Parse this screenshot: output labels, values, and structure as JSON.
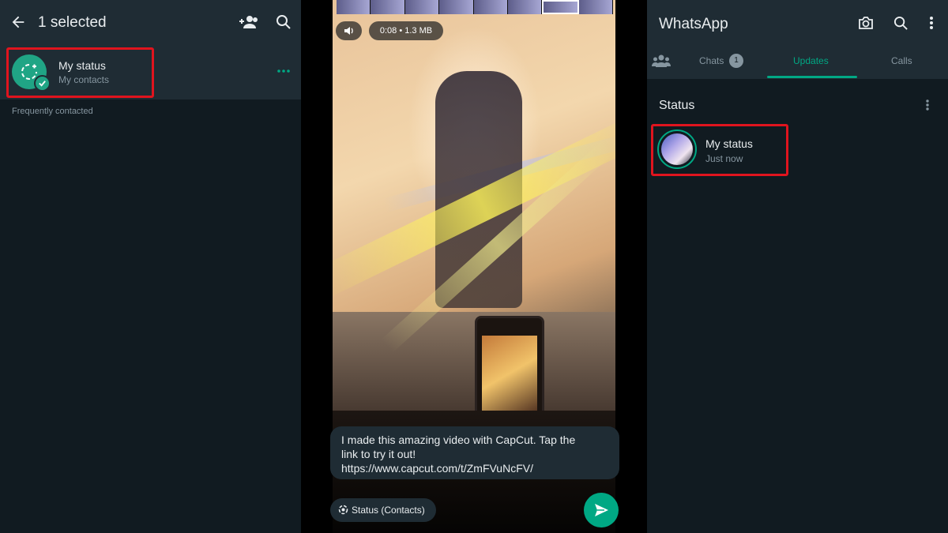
{
  "left_panel": {
    "header": {
      "title": "1 selected"
    },
    "my_status": {
      "name": "My status",
      "subtitle": "My contacts"
    },
    "section_label": "Frequently contacted"
  },
  "center_panel": {
    "video_meta": {
      "duration_size": "0:08  •  1.3 MB"
    },
    "caption": {
      "line1": "I made this amazing video with CapCut. Tap the",
      "line2": "link to try it out!",
      "line3": "https://www.capcut.com/t/ZmFVuNcFV/"
    },
    "status_chip": "Status (Contacts)"
  },
  "right_panel": {
    "app_title": "WhatsApp",
    "tabs": [
      {
        "label": "Chats",
        "badge": "1"
      },
      {
        "label": "Updates"
      },
      {
        "label": "Calls"
      }
    ],
    "status_heading": "Status",
    "my_status": {
      "name": "My status",
      "time": "Just now"
    }
  },
  "colors": {
    "accent": "#00a884",
    "highlight_border": "#e0141e",
    "panel_bg": "#111b21",
    "header_bg": "#1f2c34"
  },
  "icons": [
    "back-arrow-icon",
    "add-contacts-icon",
    "search-icon",
    "status-ring-icon",
    "check-icon",
    "more-dots-icon",
    "volume-icon",
    "status-icon",
    "send-icon",
    "camera-icon",
    "menu-icon",
    "community-icon"
  ]
}
